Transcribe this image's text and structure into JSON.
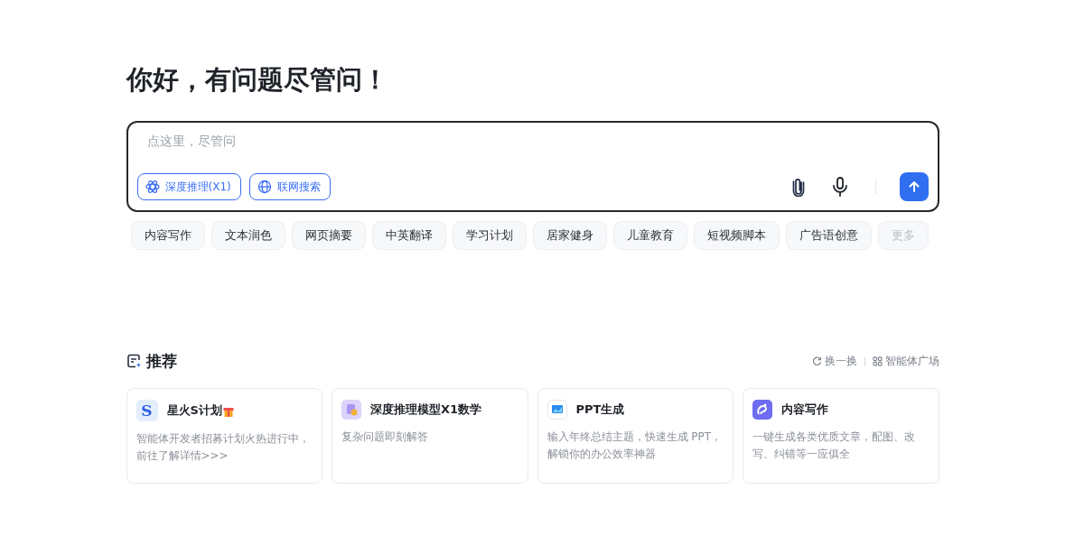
{
  "greeting": "你好，有问题尽管问！",
  "composer": {
    "placeholder": "点这里，尽管问",
    "toggles": [
      {
        "label": "深度推理(X1)",
        "kind": "atom",
        "selected": true
      },
      {
        "label": "联网搜索",
        "kind": "globe",
        "selected": true
      }
    ]
  },
  "chips": [
    {
      "label": "内容写作",
      "disabled": false
    },
    {
      "label": "文本润色",
      "disabled": false
    },
    {
      "label": "网页摘要",
      "disabled": false
    },
    {
      "label": "中英翻译",
      "disabled": false
    },
    {
      "label": "学习计划",
      "disabled": false
    },
    {
      "label": "居家健身",
      "disabled": false
    },
    {
      "label": "儿童教育",
      "disabled": false
    },
    {
      "label": "短视频脚本",
      "disabled": false
    },
    {
      "label": "广告语创意",
      "disabled": false
    },
    {
      "label": "更多",
      "disabled": true
    }
  ],
  "recommend": {
    "title": "推荐",
    "actions": [
      {
        "label": "换一换",
        "kind": "refresh"
      },
      {
        "label": "智能体广场",
        "kind": "grid"
      }
    ],
    "cards": [
      {
        "kind": "letter",
        "glyph": "S",
        "title": "星火S计划",
        "gift": true,
        "description": "智能体开发者招募计划火热进行中，前往了解详情>>>"
      },
      {
        "kind": "math",
        "title": "深度推理模型X1数学",
        "gift": false,
        "description": "复杂问题即刻解答"
      },
      {
        "kind": "slides",
        "title": "PPT生成",
        "gift": false,
        "description": "输入年终总结主题，快速生成 PPT，解锁你的办公效率神器"
      },
      {
        "kind": "writing",
        "title": "内容写作",
        "gift": false,
        "description": "一键生成各类优质文章，配图、改写、纠错等一应俱全"
      }
    ]
  }
}
